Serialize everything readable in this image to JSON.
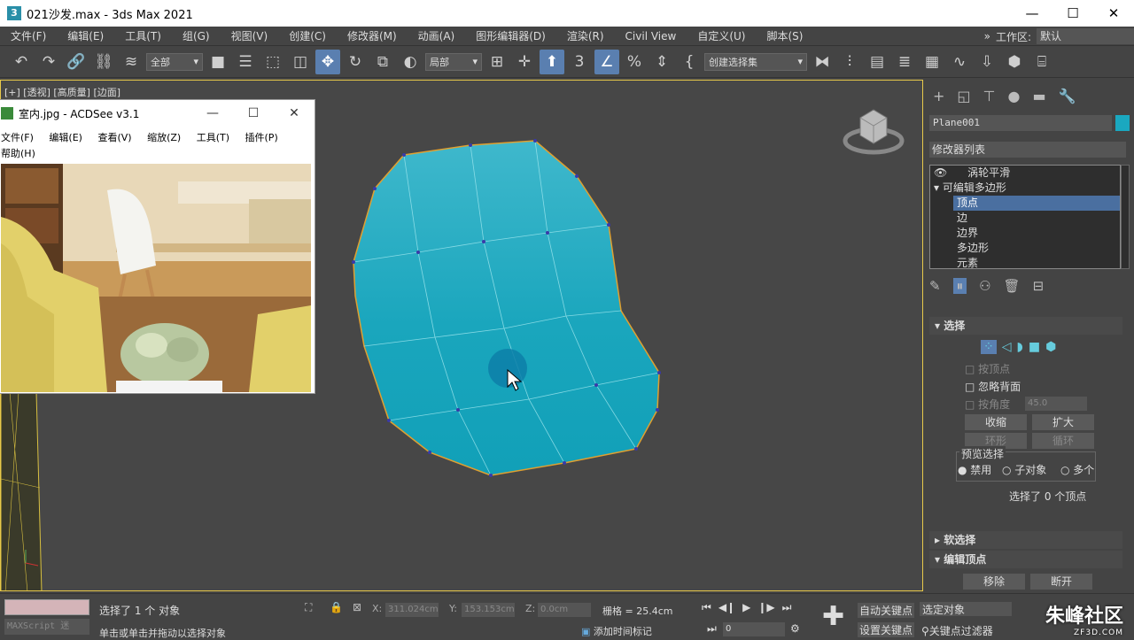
{
  "window": {
    "title": "021沙发.max - 3ds Max 2021",
    "app_icon": "3",
    "min": "—",
    "max": "☐",
    "close": "✕"
  },
  "menu": {
    "items": [
      "文件(F)",
      "编辑(E)",
      "工具(T)",
      "组(G)",
      "视图(V)",
      "创建(C)",
      "修改器(M)",
      "动画(A)",
      "图形编辑器(D)",
      "渲染(R)",
      "Civil View",
      "自定义(U)",
      "脚本(S)"
    ],
    "workspace_label": "工作区:",
    "workspace_value": "默认"
  },
  "toolbar": {
    "filter": "全部",
    "refcoord": "局部",
    "named_sel": "创建选择集"
  },
  "viewport": {
    "label": "[+] [透视] [高质量] [边面]"
  },
  "acdsee": {
    "title": "室内.jpg - ACDSee v3.1",
    "menu": [
      "文件(F)",
      "编辑(E)",
      "查看(V)",
      "缩放(Z)",
      "工具(T)",
      "插件(P)"
    ],
    "menu2": "帮助(H)",
    "min": "—",
    "max": "☐",
    "close": "✕"
  },
  "panel": {
    "object_name": "Plane001",
    "object_color": "#1aa8c0",
    "modifier_list": "修改器列表",
    "stack": [
      "涡轮平滑",
      "可编辑多边形",
      "顶点",
      "边",
      "边界",
      "多边形",
      "元素"
    ],
    "selection": {
      "title": "选择",
      "by_vertex": "按顶点",
      "ignore_backface": "忽略背面",
      "by_angle": "按角度",
      "angle_value": "45.0",
      "shrink": "收缩",
      "grow": "扩大",
      "ring": "环形",
      "loop": "循环",
      "preview_label": "预览选择",
      "preview_options": [
        "禁用",
        "子对象",
        "多个"
      ],
      "status": "选择了 0 个顶点"
    },
    "soft_selection": "软选择",
    "edit_vertices": "编辑顶点",
    "remove": "移除",
    "break": "断开"
  },
  "status": {
    "maxscript": "MAXScript 迷",
    "selected": "选择了 1 个 对象",
    "prompt": "单击或单击并拖动以选择对象",
    "x_label": "X:",
    "x": "311.024cm",
    "y_label": "Y:",
    "y": "153.153cm",
    "z_label": "Z:",
    "z": "0.0cm",
    "grid": "栅格 = 25.4cm",
    "add_time_tag": "添加时间标记",
    "frame": "0",
    "auto_key": "自动关键点",
    "set_key": "设置关键点",
    "selected_obj": "选定对象",
    "key_filter": "关键点过滤器"
  },
  "watermark": {
    "brand": "朱峰社区",
    "url": "ZF3D.COM"
  }
}
